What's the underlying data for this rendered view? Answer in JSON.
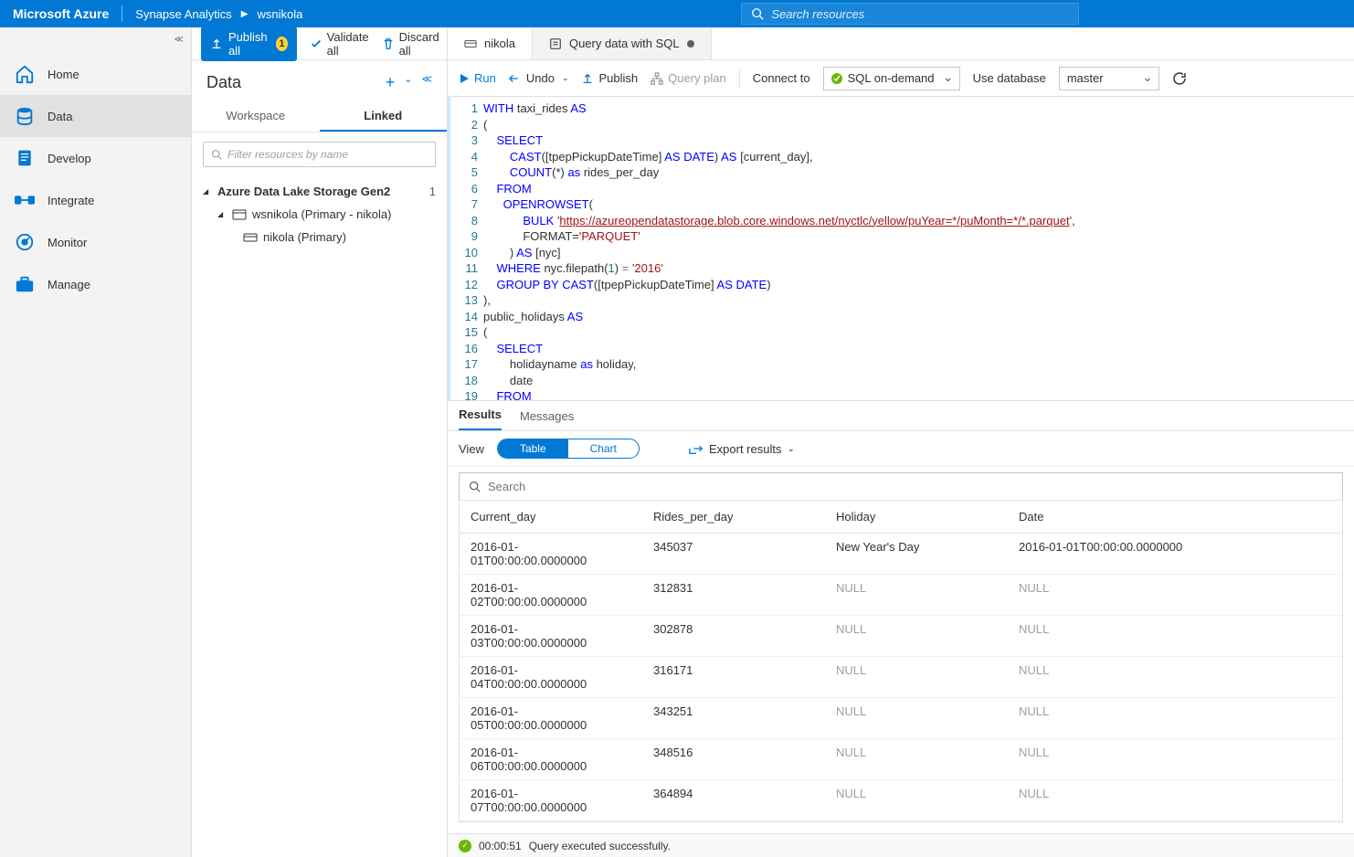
{
  "header": {
    "brand": "Microsoft Azure",
    "breadcrumb1": "Synapse Analytics",
    "breadcrumb2": "wsnikola",
    "search_placeholder": "Search resources"
  },
  "nav": {
    "items": [
      {
        "label": "Home"
      },
      {
        "label": "Data"
      },
      {
        "label": "Develop"
      },
      {
        "label": "Integrate"
      },
      {
        "label": "Monitor"
      },
      {
        "label": "Manage"
      }
    ]
  },
  "actions": {
    "publish_all": "Publish all",
    "publish_count": "1",
    "validate_all": "Validate all",
    "discard_all": "Discard all"
  },
  "data_panel": {
    "title": "Data",
    "tabs": {
      "workspace": "Workspace",
      "linked": "Linked"
    },
    "filter_placeholder": "Filter resources by name",
    "tree": {
      "root": "Azure Data Lake Storage Gen2",
      "root_count": "1",
      "ws": "wsnikola (Primary - nikola)",
      "container": "nikola (Primary)"
    }
  },
  "file_tabs": {
    "tab1": "nikola",
    "tab2": "Query data with SQL"
  },
  "toolbar": {
    "run": "Run",
    "undo": "Undo",
    "publish": "Publish",
    "query_plan": "Query plan",
    "connect_to": "Connect to",
    "sql_on_demand": "SQL on-demand",
    "use_database": "Use database",
    "master": "master"
  },
  "code": {
    "lines": [
      {
        "n": "1",
        "html": "<span class='kw'>WITH</span> taxi_rides <span class='kw'>AS</span>"
      },
      {
        "n": "2",
        "html": "("
      },
      {
        "n": "3",
        "html": "    <span class='kw'>SELECT</span>"
      },
      {
        "n": "4",
        "html": "        <span class='kw'>CAST</span>([tpepPickupDateTime] <span class='kw'>AS</span> <span class='kw'>DATE</span>) <span class='kw'>AS</span> [current_day],"
      },
      {
        "n": "5",
        "html": "        <span class='kw'>COUNT</span>(*) <span class='kw'>as</span> rides_per_day"
      },
      {
        "n": "6",
        "html": "    <span class='kw'>FROM</span>"
      },
      {
        "n": "7",
        "html": "      <span class='kw'>OPENROWSET</span>("
      },
      {
        "n": "8",
        "html": "            <span class='kw'>BULK</span> <span class='str'>'</span><span class='url'>https://azureopendatastorage.blob.core.windows.net/nyctlc/yellow/puYear=*/puMonth=*/*.parquet</span><span class='str'>'</span>,"
      },
      {
        "n": "9",
        "html": "            FORMAT=<span class='str'>'PARQUET'</span>"
      },
      {
        "n": "10",
        "html": "        ) <span class='kw'>AS</span> [nyc]"
      },
      {
        "n": "11",
        "html": "    <span class='kw'>WHERE</span> nyc.filepath(<span class='num'>1</span>) <span class='op'>=</span> <span class='str'>'2016'</span>"
      },
      {
        "n": "12",
        "html": "    <span class='kw'>GROUP BY</span> <span class='kw'>CAST</span>([tpepPickupDateTime] <span class='kw'>AS</span> <span class='kw'>DATE</span>)"
      },
      {
        "n": "13",
        "html": "),"
      },
      {
        "n": "14",
        "html": "public_holidays <span class='kw'>AS</span>"
      },
      {
        "n": "15",
        "html": "("
      },
      {
        "n": "16",
        "html": "    <span class='kw'>SELECT</span>"
      },
      {
        "n": "17",
        "html": "        holidayname <span class='kw'>as</span> holiday,"
      },
      {
        "n": "18",
        "html": "        date"
      },
      {
        "n": "19",
        "html": "    <span class='kw'>FROM</span>"
      }
    ]
  },
  "results": {
    "tabs": {
      "results": "Results",
      "messages": "Messages"
    },
    "view_label": "View",
    "table_label": "Table",
    "chart_label": "Chart",
    "export": "Export results",
    "search_placeholder": "Search",
    "columns": [
      "Current_day",
      "Rides_per_day",
      "Holiday",
      "Date"
    ],
    "rows": [
      {
        "c0": "2016-01-01T00:00:00.0000000",
        "c1": "345037",
        "c2": "New Year's Day",
        "c3": "2016-01-01T00:00:00.0000000"
      },
      {
        "c0": "2016-01-02T00:00:00.0000000",
        "c1": "312831",
        "c2": "NULL",
        "c3": "NULL"
      },
      {
        "c0": "2016-01-03T00:00:00.0000000",
        "c1": "302878",
        "c2": "NULL",
        "c3": "NULL"
      },
      {
        "c0": "2016-01-04T00:00:00.0000000",
        "c1": "316171",
        "c2": "NULL",
        "c3": "NULL"
      },
      {
        "c0": "2016-01-05T00:00:00.0000000",
        "c1": "343251",
        "c2": "NULL",
        "c3": "NULL"
      },
      {
        "c0": "2016-01-06T00:00:00.0000000",
        "c1": "348516",
        "c2": "NULL",
        "c3": "NULL"
      },
      {
        "c0": "2016-01-07T00:00:00.0000000",
        "c1": "364894",
        "c2": "NULL",
        "c3": "NULL"
      }
    ]
  },
  "status": {
    "time": "00:00:51",
    "message": "Query executed successfully."
  }
}
